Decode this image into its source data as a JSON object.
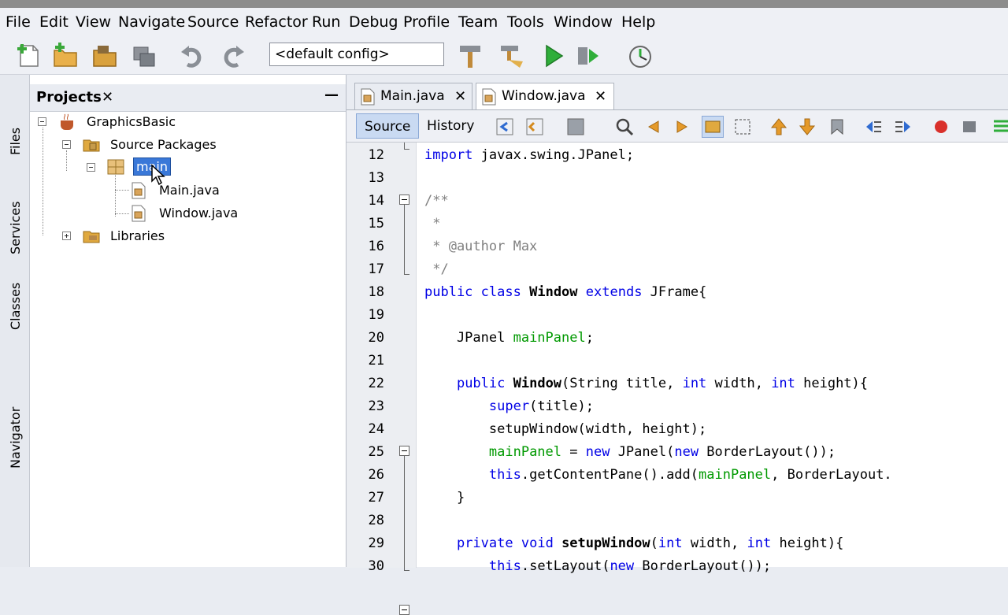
{
  "menu": [
    "File",
    "Edit",
    "View",
    "Navigate",
    "Source",
    "Refactor",
    "Run",
    "Debug",
    "Profile",
    "Team",
    "Tools",
    "Window",
    "Help"
  ],
  "toolbar": {
    "config": "<default config>",
    "icons": [
      "new-file-icon",
      "new-project-icon",
      "open-project-icon",
      "close-project-icon",
      "undo-icon",
      "redo-icon",
      "build-icon",
      "clean-build-icon",
      "run-icon",
      "debug-icon",
      "profile-icon"
    ]
  },
  "side_tabs": [
    "Files",
    "Services",
    "Classes",
    "Navigator"
  ],
  "projects": {
    "title": "Projects",
    "close": "✕",
    "minimize": "—",
    "tree": {
      "project": "GraphicsBasic",
      "source_packages": "Source Packages",
      "package": "main",
      "files": [
        "Main.java",
        "Window.java"
      ],
      "libraries": "Libraries"
    }
  },
  "editor": {
    "tabs": [
      {
        "label": "Main.java",
        "close": "✕"
      },
      {
        "label": "Window.java",
        "close": "✕"
      }
    ],
    "modes": [
      "Source",
      "History"
    ],
    "lines": [
      {
        "n": "12",
        "t": "import javax.swing.JPanel;"
      },
      {
        "n": "13",
        "t": ""
      },
      {
        "n": "14",
        "t": "/**"
      },
      {
        "n": "15",
        "t": " *"
      },
      {
        "n": "16",
        "t": " * @author Max"
      },
      {
        "n": "17",
        "t": " */"
      },
      {
        "n": "18",
        "t": "public class Window extends JFrame{"
      },
      {
        "n": "19",
        "t": ""
      },
      {
        "n": "20",
        "t": "    JPanel mainPanel;"
      },
      {
        "n": "21",
        "t": ""
      },
      {
        "n": "22",
        "t": "    public Window(String title, int width, int height){"
      },
      {
        "n": "23",
        "t": "        super(title);"
      },
      {
        "n": "24",
        "t": "        setupWindow(width, height);"
      },
      {
        "n": "25",
        "t": "        mainPanel = new JPanel(new BorderLayout());"
      },
      {
        "n": "26",
        "t": "        this.getContentPane().add(mainPanel, BorderLayout."
      },
      {
        "n": "27",
        "t": "    }"
      },
      {
        "n": "28",
        "t": ""
      },
      {
        "n": "29",
        "t": "    private void setupWindow(int width, int height){"
      },
      {
        "n": "30",
        "t": "        this.setLayout(new BorderLayout());"
      }
    ]
  },
  "colors": {
    "keyword": "#0000e6",
    "comment": "#808080",
    "field": "#009900",
    "selection": "#3a78d8"
  }
}
